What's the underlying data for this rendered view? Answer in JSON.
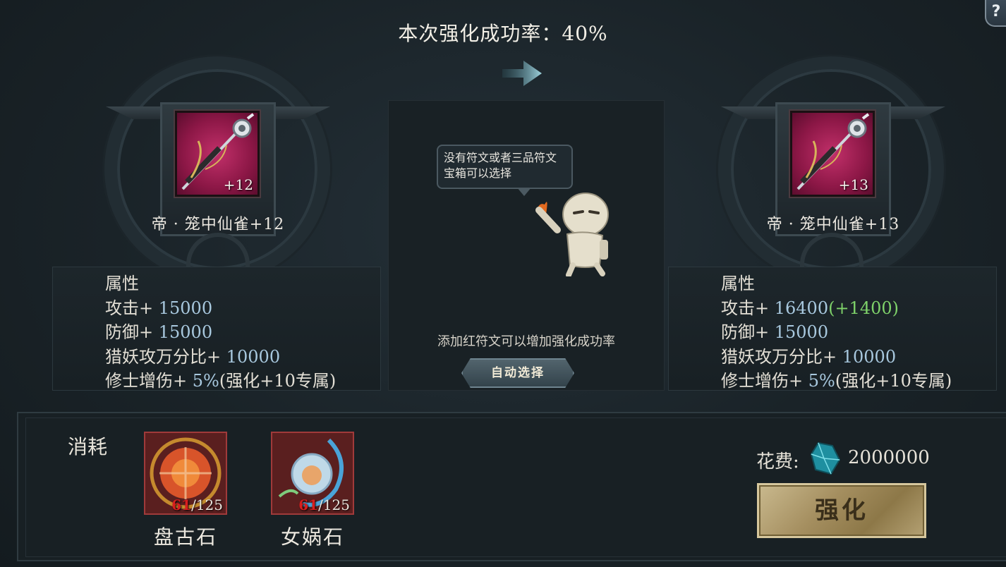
{
  "header": {
    "success_rate_text": "本次强化成功率：40%",
    "help_label": "?"
  },
  "current_item": {
    "name": "帝 · 笼中仙雀+12",
    "level_badge": "+12",
    "stats_title": "属性",
    "stats": [
      {
        "label": "攻击+ ",
        "value": "15000",
        "bonus": ""
      },
      {
        "label": "防御+ ",
        "value": "15000",
        "bonus": ""
      },
      {
        "label": "猎妖攻万分比+ ",
        "value": "10000",
        "bonus": ""
      },
      {
        "label": "修士增伤+ ",
        "value": "5%",
        "suffix": "(强化+10专属)",
        "bonus": ""
      }
    ]
  },
  "next_item": {
    "name": "帝 · 笼中仙雀+13",
    "level_badge": "+13",
    "stats_title": "属性",
    "stats": [
      {
        "label": "攻击+ ",
        "value": "16400",
        "bonus": "(+1400)"
      },
      {
        "label": "防御+ ",
        "value": "15000",
        "bonus": ""
      },
      {
        "label": "猎妖攻万分比+ ",
        "value": "10000",
        "bonus": ""
      },
      {
        "label": "修士增伤+ ",
        "value": "5%",
        "suffix": "(强化+10专属)",
        "bonus": ""
      }
    ]
  },
  "rune_panel": {
    "bubble_text": "没有符文或者三品符文宝箱可以选择",
    "hint_text": "添加红符文可以增加强化成功率",
    "auto_select_label": "自动选择"
  },
  "cost": {
    "label": "消耗",
    "materials": [
      {
        "name": "盘古石",
        "have": "61",
        "need": "/125"
      },
      {
        "name": "女娲石",
        "have": "61",
        "need": "/125"
      }
    ],
    "fee_label": "花费:",
    "fee_value": "2000000",
    "enhance_label": "强化"
  },
  "colors": {
    "stat_value": "#a8c8de",
    "bonus_green": "#7fd36a",
    "insufficient_red": "#d81e1e",
    "enhance_gold": "#b4a173"
  },
  "icons": {
    "arrow": "right-arrow-icon",
    "weapon": "spear-icon",
    "pangu": "fire-orb-icon",
    "nvwa": "water-orb-icon",
    "currency": "jade-crystal-icon"
  }
}
